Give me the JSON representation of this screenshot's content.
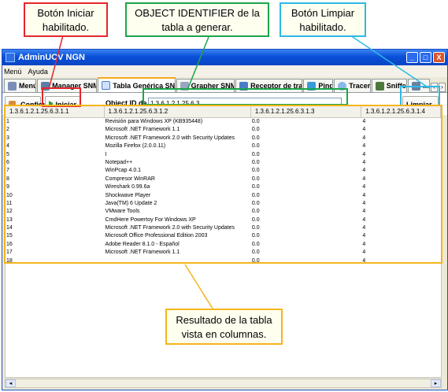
{
  "window": {
    "title": "AdminUCV NGN",
    "btn_min": "_",
    "btn_max": "□",
    "btn_close": "X"
  },
  "menu": [
    "Menú",
    "Ayuda"
  ],
  "tabs": [
    "Menú",
    "Manager SNMP",
    "Tabla Genérica SNMP",
    "Grapher SNMP",
    "Receptor de traps",
    "Ping",
    "Tracert",
    "Sniffer",
    "..."
  ],
  "tab_scroll": {
    "left": "‹",
    "right": "›"
  },
  "toolbar": {
    "configurar_label": "Configurar",
    "iniciar_label": "Iniciar",
    "oid_label": "Object ID de la tabla:",
    "oid_value": "1.3.6.1.2.1.25.6.3",
    "limpiar_label": "Limpiar"
  },
  "table": {
    "headers": [
      "1.3.6.1.2.1.25.6.3.1.1",
      "1.3.6.1.2.1.25.6.3.1.2",
      "1.3.6.1.2.1.25.6.3.1.3",
      "1.3.6.1.2.1.25.6.3.1.4"
    ],
    "rows": [
      [
        "1",
        "Revisión para Windows XP (KB935448)",
        "0.0",
        "4"
      ],
      [
        "2",
        "Microsoft .NET Framework 1.1",
        "0.0",
        "4"
      ],
      [
        "3",
        "Microsoft .NET Framework 2.0 with Security Updates",
        "0.0",
        "4"
      ],
      [
        "4",
        "Mozilla Firefox (2.0.0.11)",
        "0.0",
        "4"
      ],
      [
        "5",
        "I",
        "0.0",
        "4"
      ],
      [
        "6",
        "Notepad++",
        "0.0",
        "4"
      ],
      [
        "7",
        "WinPcap 4.0.1",
        "0.0",
        "4"
      ],
      [
        "8",
        "Compresor WinRAR",
        "0.0",
        "4"
      ],
      [
        "9",
        "Wireshark 0.99.6a",
        "0.0",
        "4"
      ],
      [
        "10",
        "Shockwave Player",
        "0.0",
        "4"
      ],
      [
        "11",
        "Java(TM) 6 Update 2",
        "0.0",
        "4"
      ],
      [
        "12",
        "VMware Tools",
        "0.0",
        "4"
      ],
      [
        "13",
        "CmdHere Powertoy For Windows XP",
        "0.0",
        "4"
      ],
      [
        "14",
        "Microsoft .NET Framework 2.0 with Security Updates",
        "0.0",
        "4"
      ],
      [
        "15",
        "Microsoft Office Professional Edition 2003",
        "0.0",
        "4"
      ],
      [
        "16",
        "Adobe Reader 8.1.0 - Español",
        "0.0",
        "4"
      ],
      [
        "17",
        "Microsoft .NET Framework 1.1",
        "0.0",
        "4"
      ],
      [
        "18",
        "",
        "0.0",
        "4"
      ]
    ]
  },
  "scroll": {
    "left": "◂",
    "right": "▸"
  },
  "callouts": {
    "iniciar": "Botón Iniciar habilitado.",
    "oid": "OBJECT IDENTIFIER de la tabla a generar.",
    "limpiar": "Botón Limpiar habilitado.",
    "resultado": "Resultado de la tabla vista en columnas."
  },
  "colors": {
    "iniciar": "#e4262c",
    "oid": "#1aa64a",
    "limpiar": "#2fb8e6",
    "resultado": "#f5b51b"
  }
}
